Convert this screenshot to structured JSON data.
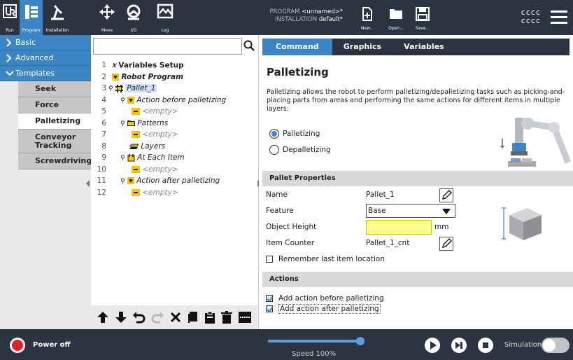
{
  "header": {
    "nav": [
      {
        "label": "Run",
        "icon": "ur-logo-icon"
      },
      {
        "label": "Program",
        "icon": "program-icon"
      },
      {
        "label": "Installation",
        "icon": "installation-icon"
      },
      {
        "label": "Move",
        "icon": "move-icon"
      },
      {
        "label": "I/O",
        "icon": "io-icon"
      },
      {
        "label": "Log",
        "icon": "log-icon"
      }
    ],
    "program_label": "PROGRAM",
    "program_value": "<unnamed>*",
    "installation_label": "INSTALLATION",
    "installation_value": "default*",
    "file_buttons": [
      {
        "label": "New...",
        "icon": "new-file-icon"
      },
      {
        "label": "Open...",
        "icon": "open-folder-icon"
      },
      {
        "label": "Save...",
        "icon": "save-icon"
      }
    ],
    "right_line1": "cccc",
    "right_line2": "cccc"
  },
  "leftnav": {
    "sections": [
      {
        "label": "Basic",
        "expanded": false
      },
      {
        "label": "Advanced",
        "expanded": false
      },
      {
        "label": "Templates",
        "expanded": true
      }
    ],
    "templates": [
      "Seek",
      "Force",
      "Palletizing",
      "Conveyor Tracking",
      "Screwdriving"
    ],
    "selected_template": "Palletizing"
  },
  "tree": {
    "search_placeholder": "",
    "rows": [
      {
        "num": "1",
        "label": "Variables Setup",
        "icon": "x-variable-icon",
        "style": "bold"
      },
      {
        "num": "2",
        "label": "Robot Program",
        "icon": "yellow-triangle-icon",
        "style": "bold-italic"
      },
      {
        "num": "3",
        "label": "Pallet_1",
        "icon": "pallet-grid-icon",
        "style": "italic-selected"
      },
      {
        "num": "4",
        "label": "Action before palletizing",
        "icon": "yellow-triangle-icon",
        "style": "italic"
      },
      {
        "num": "5",
        "label": "<empty>",
        "icon": "empty-node-icon",
        "style": "empty"
      },
      {
        "num": "6",
        "label": "Patterns",
        "icon": "folder-icon",
        "style": "italic"
      },
      {
        "num": "7",
        "label": "<empty>",
        "icon": "empty-node-icon",
        "style": "empty"
      },
      {
        "num": "8",
        "label": "Layers",
        "icon": "layers-icon",
        "style": "italic"
      },
      {
        "num": "9",
        "label": "At Each Item",
        "icon": "item-icon",
        "style": "italic"
      },
      {
        "num": "10",
        "label": "<empty>",
        "icon": "empty-node-icon",
        "style": "empty"
      },
      {
        "num": "11",
        "label": "Action after palletizing",
        "icon": "yellow-triangle-icon",
        "style": "italic"
      },
      {
        "num": "12",
        "label": "<empty>",
        "icon": "empty-node-icon",
        "style": "empty"
      }
    ],
    "tools": [
      "move-up-icon",
      "move-down-icon",
      "undo-icon",
      "redo-icon",
      "cut-icon",
      "copy-icon",
      "paste-icon",
      "delete-icon",
      "suppress-icon"
    ]
  },
  "tabs": [
    "Command",
    "Graphics",
    "Variables"
  ],
  "active_tab": "Command",
  "panel": {
    "title": "Palletizing",
    "description": "Palletizing allows the robot to perform palletizing/depalletizing tasks such as picking-and-placing parts from areas and performing the same actions for different items in multiple layers.",
    "mode_options": [
      "Palletizing",
      "Depalletizing"
    ],
    "mode_selected": "Palletizing",
    "pallet_properties_header": "Pallet Properties",
    "name_label": "Name",
    "name_value": "Pallet_1",
    "feature_label": "Feature",
    "feature_value": "Base",
    "object_height_label": "Object Height",
    "object_height_value": "",
    "object_height_unit": "mm",
    "item_counter_label": "Item Counter",
    "item_counter_value": "Pallet_1_cnt",
    "remember_label": "Remember last item location",
    "remember_checked": false,
    "actions_header": "Actions",
    "action_before_label": "Add action before palletizing",
    "action_before_checked": true,
    "action_after_label": "Add action after palletizing",
    "action_after_checked": true
  },
  "footer": {
    "power_label": "Power off",
    "speed_label": "Speed 100%",
    "speed_fraction": 1.0,
    "simulation_label": "Simulation",
    "simulation_on": false
  },
  "colors": {
    "header_bg": "#2b3440",
    "accent": "#3d86c6",
    "power_red": "#e0202a",
    "height_field": "#ffff8a"
  }
}
